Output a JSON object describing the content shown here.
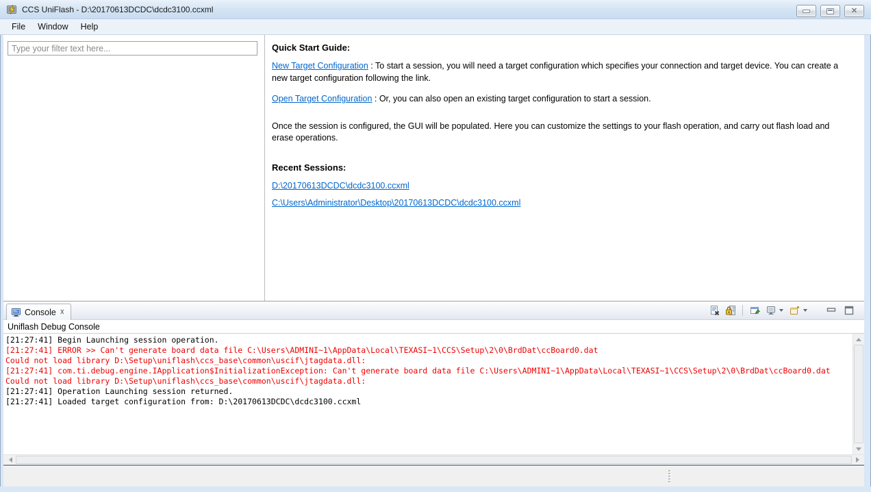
{
  "window": {
    "title": "CCS UniFlash - D:\\20170613DCDC\\dcdc3100.ccxml",
    "app_icon": "uniflash-lightning-icon",
    "controls": [
      "minimize",
      "maximize",
      "close"
    ]
  },
  "menu": {
    "items": [
      "File",
      "Window",
      "Help"
    ]
  },
  "left_panel": {
    "filter_placeholder": "Type your filter text here..."
  },
  "quick_start": {
    "title": "Quick Start Guide:",
    "items": [
      {
        "link": "New Target Configuration",
        "text": " : To start a session, you will need a target configuration which specifies your connection and target device. You can create a new target configuration following the link."
      },
      {
        "link": "Open Target Configuration",
        "text": " : Or, you can also open an existing target configuration to start a session."
      }
    ],
    "note": "Once the session is configured, the GUI will be populated. Here you can customize the settings to your flash operation, and carry out flash load and erase operations.",
    "recent_title": "Recent Sessions:",
    "recent_sessions": [
      "D:\\20170613DCDC\\dcdc3100.ccxml",
      "C:\\Users\\Administrator\\Desktop\\20170613DCDC\\dcdc3100.ccxml"
    ]
  },
  "console": {
    "tab_label": "Console",
    "subtitle": "Uniflash Debug Console",
    "toolbar_icons": [
      "clear-console",
      "scroll-lock",
      "pin-console",
      "display-selected-console",
      "open-console",
      "minimize-view",
      "maximize-view"
    ],
    "lines": [
      {
        "type": "info",
        "text": "[21:27:41] Begin Launching session operation."
      },
      {
        "type": "error",
        "text": "[21:27:41] ERROR >> Can't generate board data file C:\\Users\\ADMINI~1\\AppData\\Local\\TEXASI~1\\CCS\\Setup\\2\\0\\BrdDat\\ccBoard0.dat"
      },
      {
        "type": "error",
        "text": "Could not load library D:\\Setup\\uniflash\\ccs_base\\common\\uscif\\jtagdata.dll:"
      },
      {
        "type": "error",
        "text": "[21:27:41] com.ti.debug.engine.IApplication$InitializationException: Can't generate board data file C:\\Users\\ADMINI~1\\AppData\\Local\\TEXASI~1\\CCS\\Setup\\2\\0\\BrdDat\\ccBoard0.dat"
      },
      {
        "type": "error",
        "text": "Could not load library D:\\Setup\\uniflash\\ccs_base\\common\\uscif\\jtagdata.dll:"
      },
      {
        "type": "info",
        "text": "[21:27:41] Operation Launching session returned."
      },
      {
        "type": "info",
        "text": "[21:27:41] Loaded target configuration from: D:\\20170613DCDC\\dcdc3100.ccxml"
      }
    ]
  },
  "colors": {
    "link": "#0066cc",
    "console_error": "#ee0000",
    "console_info": "#000000",
    "frame": "#d9e7f6"
  }
}
